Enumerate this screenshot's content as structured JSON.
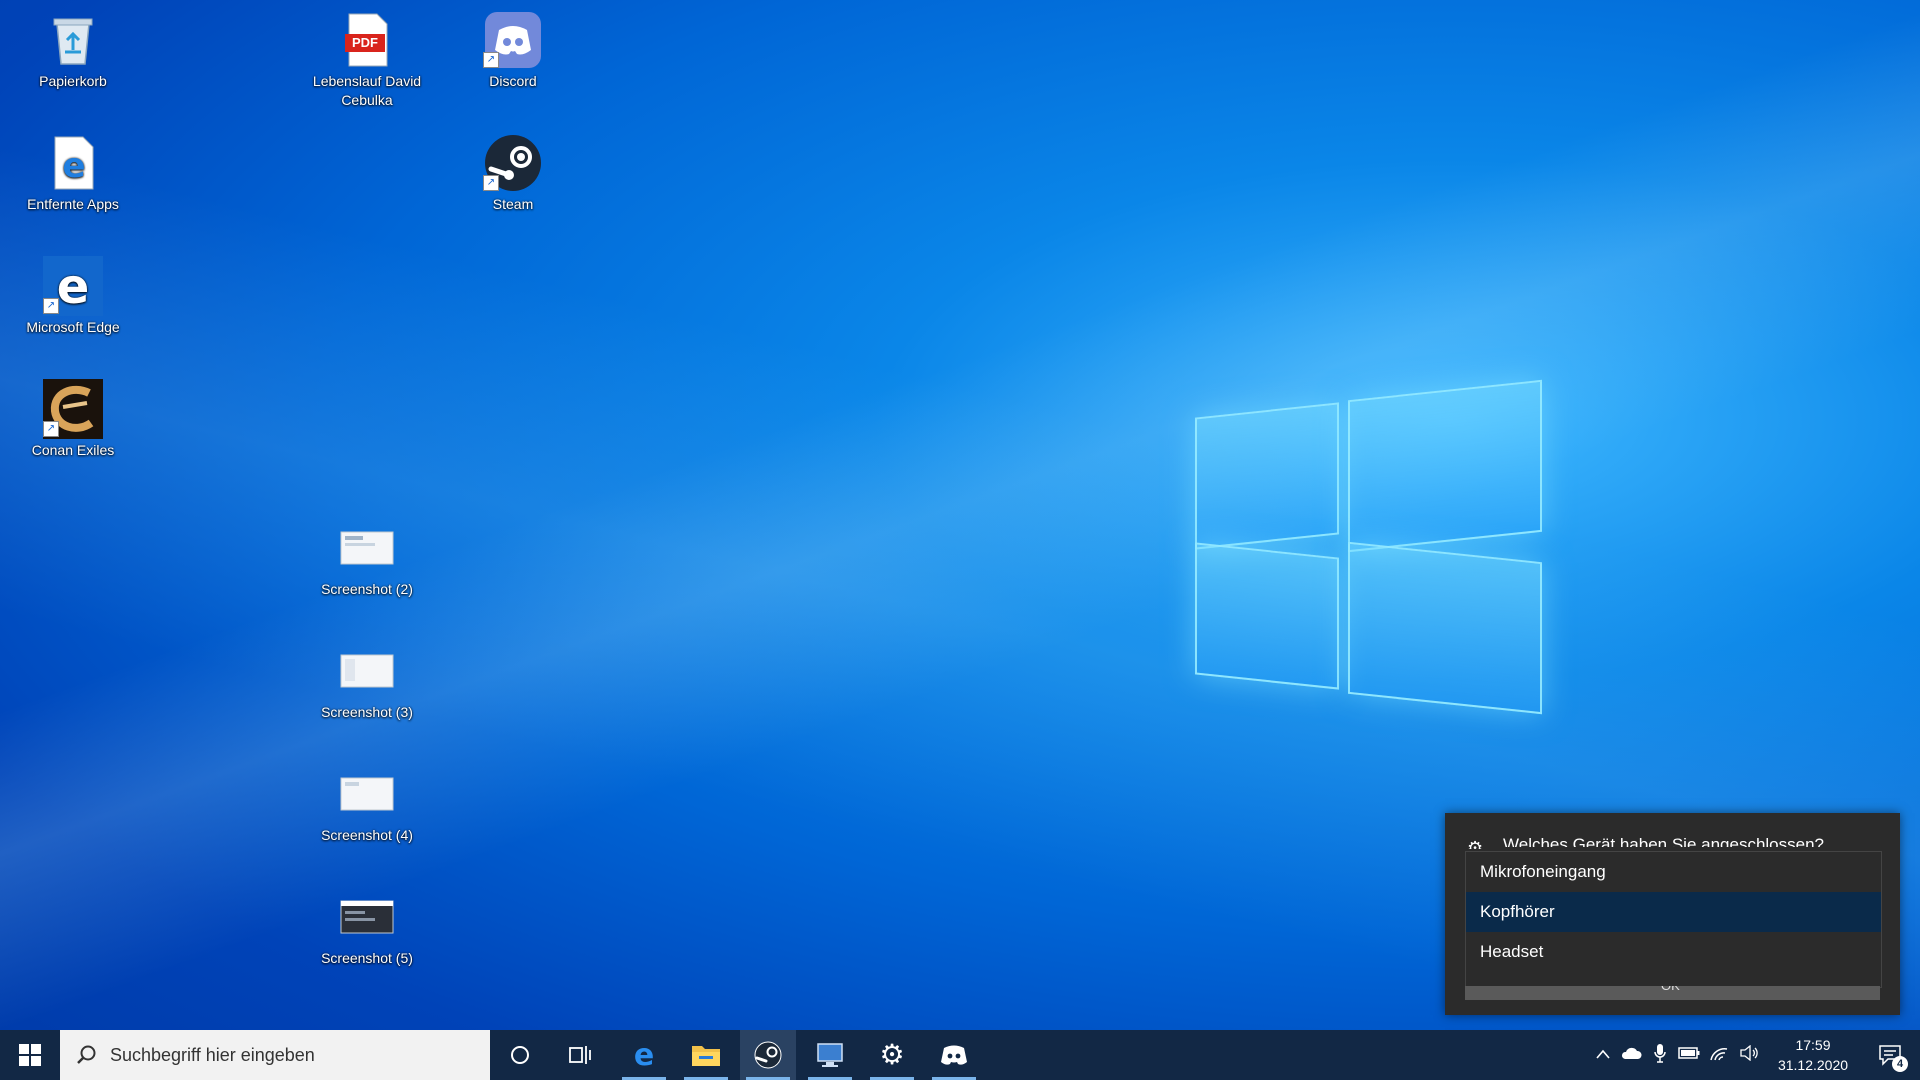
{
  "desktop": {
    "icons": [
      {
        "label": "Papierkorb"
      },
      {
        "label": "Entfernte Apps"
      },
      {
        "label": "Microsoft Edge"
      },
      {
        "label": "Conan Exiles"
      },
      {
        "label": "Lebenslauf David Cebulka"
      },
      {
        "label": "Screenshot (2)"
      },
      {
        "label": "Screenshot (3)"
      },
      {
        "label": "Screenshot (4)"
      },
      {
        "label": "Screenshot (5)"
      },
      {
        "label": "Discord"
      },
      {
        "label": "Steam"
      }
    ],
    "pdf_badge": "PDF"
  },
  "audio_dialog": {
    "title": "Welches Gerät haben Sie angeschlossen?",
    "options": [
      {
        "label": "Mikrofoneingang"
      },
      {
        "label": "Kopfhörer"
      },
      {
        "label": "Headset"
      }
    ],
    "selected": "Kopfhörer",
    "ok_label": "OK"
  },
  "taskbar": {
    "search_placeholder": "Suchbegriff hier eingeben",
    "apps": [
      "cortana-icon",
      "task-view-icon",
      "edge-icon",
      "file-explorer-icon",
      "steam-icon",
      "remote-desktop-icon",
      "settings-icon",
      "discord-icon"
    ],
    "active_app": "steam-icon",
    "tray_icons": [
      "chevron-up-icon",
      "onedrive-cloud-icon",
      "microphone-icon",
      "battery-icon",
      "wifi-icon",
      "volume-icon"
    ],
    "clock_time": "17:59",
    "clock_date": "31.12.2020",
    "notification_count": "4"
  },
  "colors": {
    "taskbar_bg": "#122845",
    "dialog_bg": "#2b2b2b",
    "selected_option_bg": "#0a2a4a",
    "accent": "#0078d7"
  }
}
